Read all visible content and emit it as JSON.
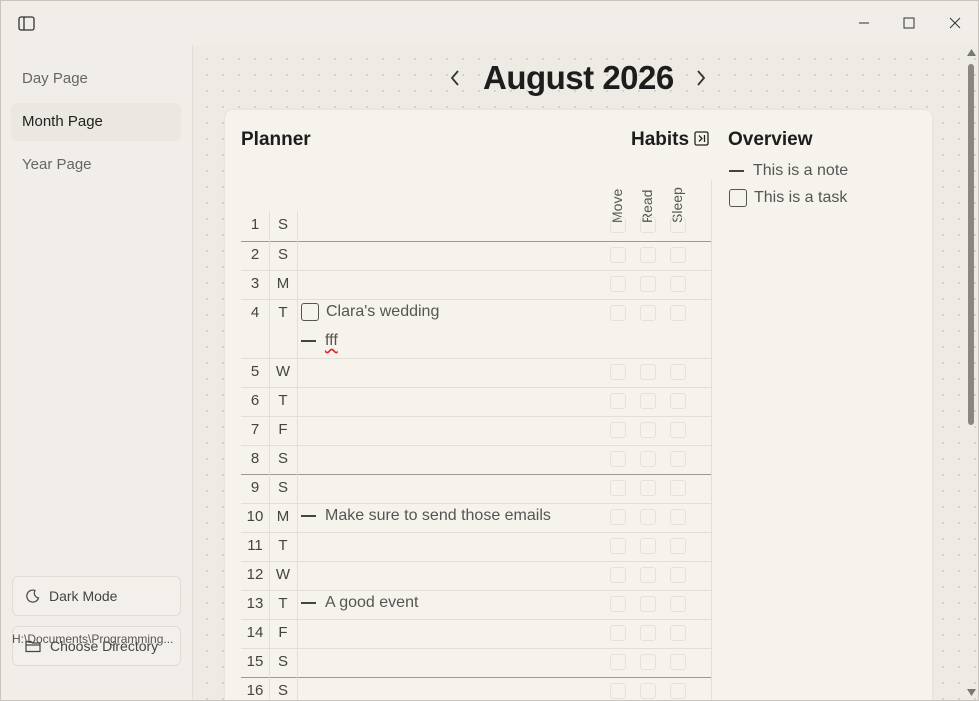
{
  "window": {
    "sidebar_toggle_icon": "sidebar-toggle-icon",
    "controls": [
      "minimize-icon",
      "maximize-icon",
      "close-icon"
    ]
  },
  "sidebar": {
    "items": [
      {
        "label": "Day Page"
      },
      {
        "label": "Month Page"
      },
      {
        "label": "Year Page"
      }
    ],
    "dark_mode_label": "Dark Mode",
    "choose_dir_label": "Choose Directory",
    "path": "H:\\Documents\\Programming..."
  },
  "header": {
    "title": "August 2026"
  },
  "planner": {
    "title": "Planner",
    "habits_title": "Habits",
    "habits": [
      "Move",
      "Read",
      "Sleep"
    ],
    "days": [
      {
        "d": "1",
        "w": "S"
      },
      {
        "d": "2",
        "w": "S"
      },
      {
        "d": "3",
        "w": "M"
      },
      {
        "d": "4",
        "w": "T",
        "entries": [
          {
            "type": "task",
            "text": "Clara's wedding"
          },
          {
            "type": "note",
            "text": "fff"
          }
        ]
      },
      {
        "d": "5",
        "w": "W"
      },
      {
        "d": "6",
        "w": "T"
      },
      {
        "d": "7",
        "w": "F"
      },
      {
        "d": "8",
        "w": "S"
      },
      {
        "d": "9",
        "w": "S"
      },
      {
        "d": "10",
        "w": "M",
        "entries": [
          {
            "type": "note",
            "text": "Make sure to send those emails"
          }
        ]
      },
      {
        "d": "11",
        "w": "T"
      },
      {
        "d": "12",
        "w": "W"
      },
      {
        "d": "13",
        "w": "T",
        "entries": [
          {
            "type": "note",
            "text": "A good event"
          }
        ]
      },
      {
        "d": "14",
        "w": "F"
      },
      {
        "d": "15",
        "w": "S"
      },
      {
        "d": "16",
        "w": "S"
      }
    ]
  },
  "overview": {
    "title": "Overview",
    "items": [
      {
        "type": "note",
        "text": "This is a note"
      },
      {
        "type": "task",
        "text": "This is a task"
      }
    ]
  }
}
